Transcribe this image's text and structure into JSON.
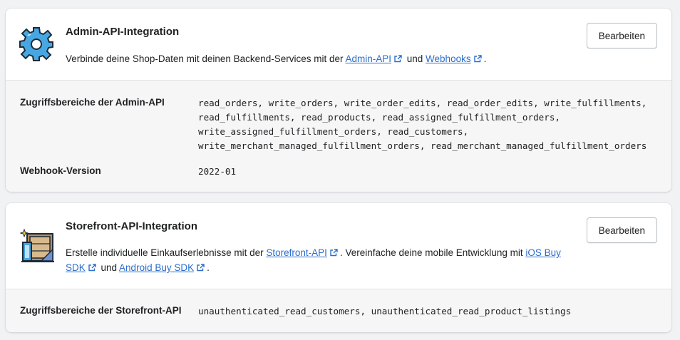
{
  "admin_api": {
    "title": "Admin-API-Integration",
    "icon": "gear-icon",
    "icon_color": "#47a7e2",
    "description_before": "Verbinde deine Shop-Daten mit deinen Backend-Services mit der ",
    "link_admin_api": "Admin-API",
    "description_middle": " und ",
    "link_webhooks": "Webhooks",
    "description_end": ".",
    "edit_label": "Bearbeiten",
    "scopes_label": "Zugriffsbereiche der Admin-API",
    "scopes_lines": [
      "read_orders, write_orders, write_order_edits, read_order_edits, write_fulfillments,",
      "read_fulfillments, read_products, read_assigned_fulfillment_orders,",
      "write_assigned_fulfillment_orders, read_customers,",
      "write_merchant_managed_fulfillment_orders, read_merchant_managed_fulfillment_orders"
    ],
    "webhook_label": "Webhook-Version",
    "webhook_version": "2022-01"
  },
  "storefront_api": {
    "title": "Storefront-API-Integration",
    "icon": "storefront-icon",
    "description_before": "Erstelle individuelle Einkaufserlebnisse mit der ",
    "link_storefront_api": "Storefront-API",
    "description_middle": ". Vereinfache deine mobile Entwicklung mit ",
    "link_ios_sdk": "iOS Buy SDK",
    "description_and": " und ",
    "link_android_sdk": "Android Buy SDK",
    "description_end": ".",
    "edit_label": "Bearbeiten",
    "scopes_label": "Zugriffsbereiche der Storefront-API",
    "scopes_value": "unauthenticated_read_customers, unauthenticated_read_product_listings"
  },
  "colors": {
    "link": "#2c6ecb",
    "background": "#f1f2f4",
    "card_body": "#f6f6f7"
  }
}
